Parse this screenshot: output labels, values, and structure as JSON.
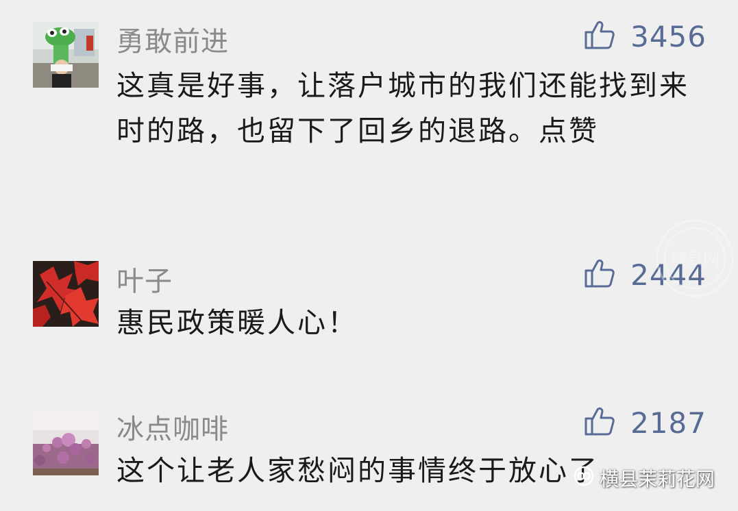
{
  "comments": [
    {
      "username": "勇敢前进",
      "likes": "3456",
      "avatar": "kid-with-frog-mascot",
      "text": "这真是好事，让落户城市的我们还能找到来时的路，也留下了回乡的退路。点赞"
    },
    {
      "username": "叶子",
      "likes": "2444",
      "avatar": "red-maple-leaves",
      "text": "惠民政策暖人心！"
    },
    {
      "username": "冰点咖啡",
      "likes": "2187",
      "avatar": "purple-flower-field",
      "text": "这个让老人家愁闷的事情终于放心了"
    }
  ],
  "watermark": {
    "brand": "横县茉莉花网",
    "seal_text": "横县网"
  },
  "colors": {
    "background": "#efefef",
    "username": "#8a8a8a",
    "like_accent": "#576b95",
    "text": "#1a1a1a"
  },
  "icons": {
    "like": "thumbs-up-icon",
    "brand": "wechat-channel-icon"
  }
}
